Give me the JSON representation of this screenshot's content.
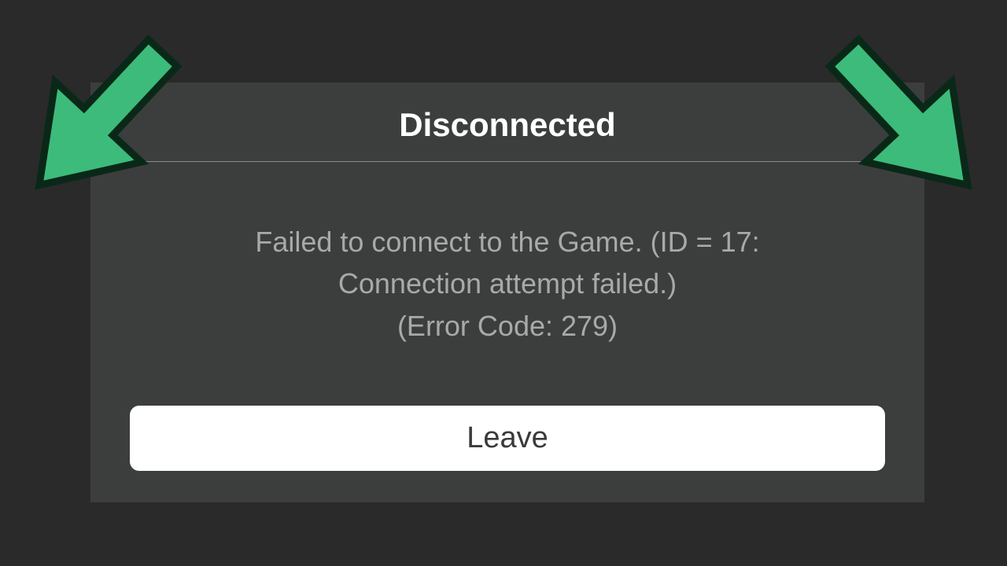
{
  "dialog": {
    "title": "Disconnected",
    "message": "Failed to connect to the Game. (ID = 17:\nConnection attempt failed.)\n(Error Code: 279)",
    "leave_label": "Leave"
  },
  "colors": {
    "arrow": "#3dbb7a",
    "arrow_stroke": "#0a2818"
  }
}
